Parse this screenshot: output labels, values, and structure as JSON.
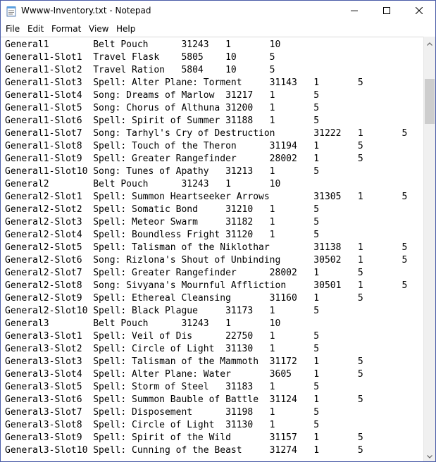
{
  "window": {
    "title": "Wwww-Inventory.txt - Notepad"
  },
  "menu": {
    "file": "File",
    "edit": "Edit",
    "format": "Format",
    "view": "View",
    "help": "Help"
  },
  "icons": {
    "app": "notepad-icon",
    "minimize": "minimize-icon",
    "maximize": "maximize-icon",
    "close": "close-icon",
    "scroll_up": "chevron-up-icon",
    "scroll_down": "chevron-down-icon"
  },
  "document": {
    "content": "General1        Belt Pouch      31243   1       10\nGeneral1-Slot1  Travel Flask    5805    10      5\nGeneral1-Slot2  Travel Ration   5804    10      5\nGeneral1-Slot3  Spell: Alter Plane: Torment     31143   1       5\nGeneral1-Slot4  Song: Dreams of Marlow  31217   1       5\nGeneral1-Slot5  Song: Chorus of Althuna 31200   1       5\nGeneral1-Slot6  Spell: Spirit of Summer 31188   1       5\nGeneral1-Slot7  Song: Tarhyl's Cry of Destruction       31222   1       5\nGeneral1-Slot8  Spell: Touch of the Theron      31194   1       5\nGeneral1-Slot9  Spell: Greater Rangefinder      28002   1       5\nGeneral1-Slot10 Song: Tunes of Apathy   31213   1       5\nGeneral2        Belt Pouch      31243   1       10\nGeneral2-Slot1  Spell: Summon Heartseeker Arrows        31305   1       5\nGeneral2-Slot2  Spell: Somatic Bond     31210   1       5\nGeneral2-Slot3  Spell: Meteor Swarm     31182   1       5\nGeneral2-Slot4  Spell: Boundless Fright 31120   1       5\nGeneral2-Slot5  Spell: Talisman of the Niklothar        31138   1       5\nGeneral2-Slot6  Song: Rizlona's Shout of Unbinding      30502   1       5\nGeneral2-Slot7  Spell: Greater Rangefinder      28002   1       5\nGeneral2-Slot8  Song: Sivyana's Mournful Affliction     30501   1       5\nGeneral2-Slot9  Spell: Ethereal Cleansing       31160   1       5\nGeneral2-Slot10 Spell: Black Plague     31173   1       5\nGeneral3        Belt Pouch      31243   1       10\nGeneral3-Slot1  Spell: Veil of Dis      22750   1       5\nGeneral3-Slot2  Spell: Circle of Light  31130   1       5\nGeneral3-Slot3  Spell: Talisman of the Mammoth  31172   1       5\nGeneral3-Slot4  Spell: Alter Plane: Water       3605    1       5\nGeneral3-Slot5  Spell: Storm of Steel   31183   1       5\nGeneral3-Slot6  Spell: Summon Bauble of Battle  31124   1       5\nGeneral3-Slot7  Spell: Disposement      31198   1       5\nGeneral3-Slot8  Spell: Circle of Light  31130   1       5\nGeneral3-Slot9  Spell: Spirit of the Wild       31157   1       5\nGeneral3-Slot10 Spell: Cunning of the Beast     31274   1       5"
  },
  "colors": {
    "window_border": "#4a5ca8",
    "scroll_thumb": "#cdcdcd",
    "scroll_track": "#f0f0f0"
  }
}
